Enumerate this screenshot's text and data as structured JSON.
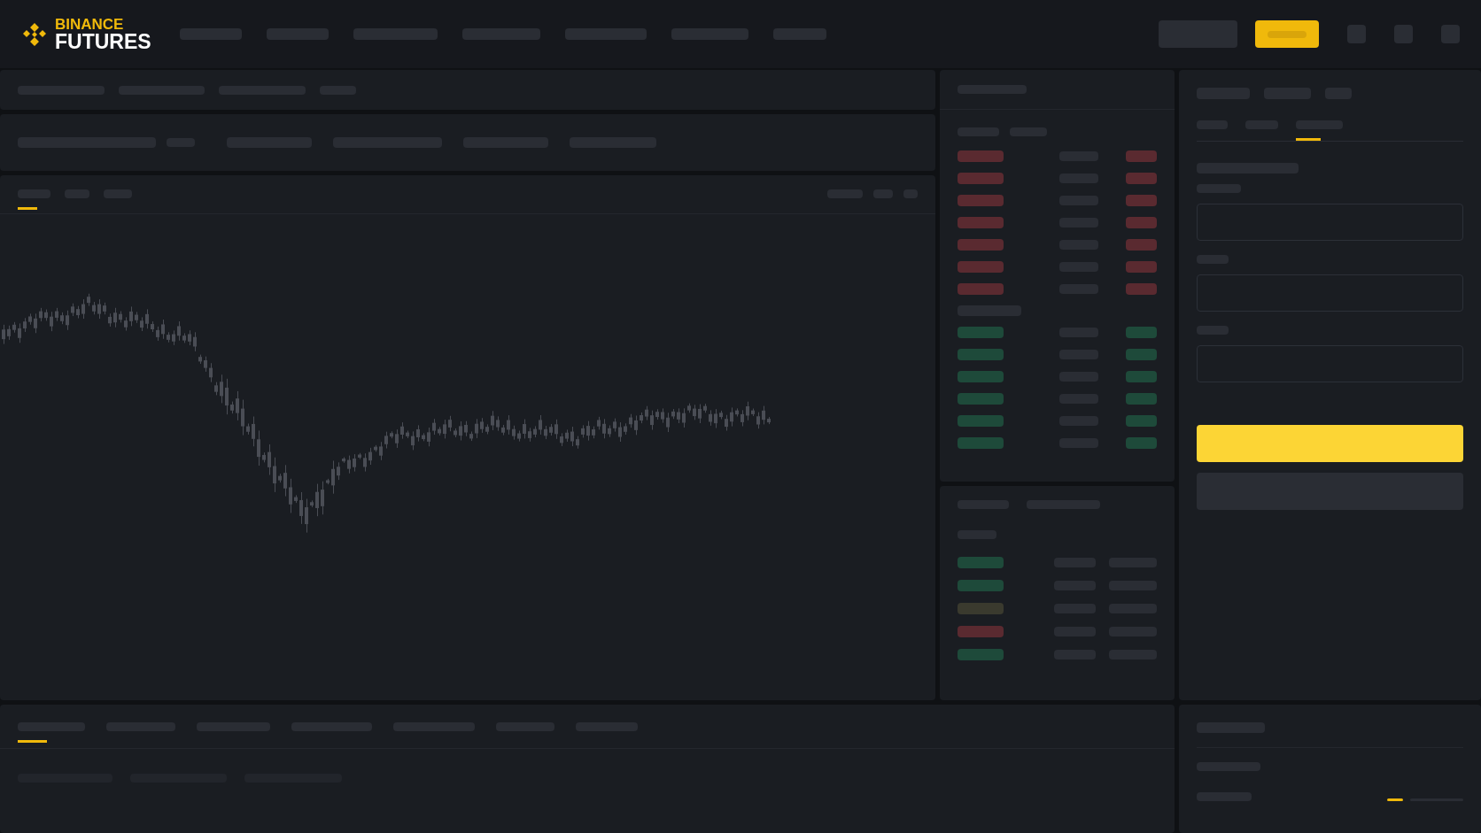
{
  "logo": {
    "brand": "BINANCE",
    "product": "FUTURES"
  },
  "chart_tabs": [
    {
      "selected": true
    },
    {
      "selected": false
    },
    {
      "selected": false
    }
  ],
  "order_book_rows": [
    {
      "kind": "ask"
    },
    {
      "kind": "ask"
    },
    {
      "kind": "ask"
    },
    {
      "kind": "ask"
    },
    {
      "kind": "ask"
    },
    {
      "kind": "ask"
    },
    {
      "kind": "ask"
    },
    {
      "kind": "bid"
    },
    {
      "kind": "bid"
    },
    {
      "kind": "bid"
    },
    {
      "kind": "bid"
    },
    {
      "kind": "bid"
    },
    {
      "kind": "bid"
    }
  ],
  "trades": [
    {
      "color": "#1e4a3a"
    },
    {
      "color": "#1e4a3a"
    },
    {
      "color": "#3a3a2e"
    },
    {
      "color": "#5a2a30"
    },
    {
      "color": "#1e4a3a"
    }
  ],
  "order_form_tabs": [
    {
      "selected": false
    },
    {
      "selected": false
    },
    {
      "selected": true
    }
  ],
  "bottom_tabs": [
    {
      "selected": true
    },
    {
      "selected": false
    },
    {
      "selected": false
    },
    {
      "selected": false
    },
    {
      "selected": false
    },
    {
      "selected": false
    },
    {
      "selected": false
    }
  ],
  "account_tabs": [
    {
      "selected": true
    },
    {
      "selected": false
    }
  ]
}
